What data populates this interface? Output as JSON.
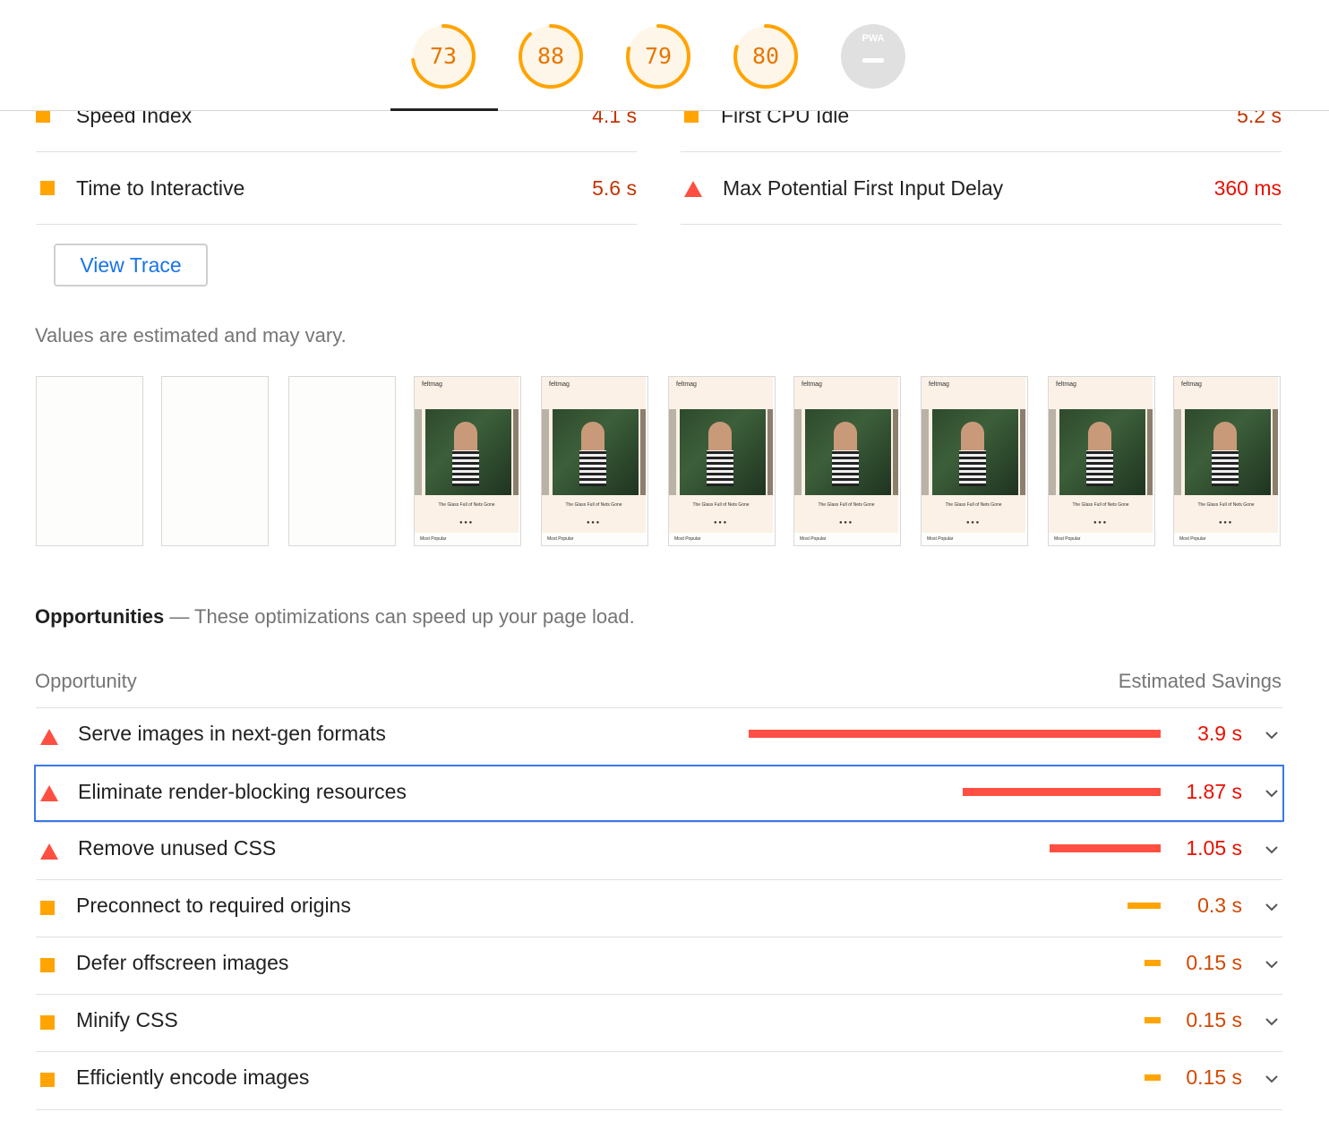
{
  "scores": [
    {
      "value": "73",
      "color": "#ffa400"
    },
    {
      "value": "88",
      "color": "#ffa400"
    },
    {
      "value": "79",
      "color": "#ffa400"
    },
    {
      "value": "80",
      "color": "#ffa400"
    }
  ],
  "pwa": {
    "badge": "PWA"
  },
  "metrics": {
    "speed_index": {
      "label": "Speed Index",
      "value": "4.1 s"
    },
    "first_cpu_idle": {
      "label": "First CPU Idle",
      "value": "5.2 s"
    },
    "tti": {
      "label": "Time to Interactive",
      "value": "5.6 s"
    },
    "max_fid": {
      "label": "Max Potential First Input Delay",
      "value": "360 ms"
    }
  },
  "view_trace_label": "View Trace",
  "estimate_note": "Values are estimated and may vary.",
  "filmstrip": {
    "logo": "feltmag",
    "caption": "The Glass Full of Nets Gone",
    "dots": "● ● ●",
    "footer": "Most Popular"
  },
  "opportunities": {
    "title": "Opportunities",
    "separator": " — ",
    "subtitle": "These optimizations can speed up your page load.",
    "col_opportunity": "Opportunity",
    "col_savings": "Estimated Savings",
    "items": [
      {
        "label": "Serve images in next-gen formats",
        "savings": "3.9 s",
        "severity": "fail",
        "bar_fraction": 1.0
      },
      {
        "label": "Eliminate render-blocking resources",
        "savings": "1.87 s",
        "severity": "fail",
        "bar_fraction": 0.48
      },
      {
        "label": "Remove unused CSS",
        "savings": "1.05 s",
        "severity": "fail",
        "bar_fraction": 0.27
      },
      {
        "label": "Preconnect to required origins",
        "savings": "0.3 s",
        "severity": "average",
        "bar_fraction": 0.08
      },
      {
        "label": "Defer offscreen images",
        "savings": "0.15 s",
        "severity": "average",
        "bar_fraction": 0.04
      },
      {
        "label": "Minify CSS",
        "savings": "0.15 s",
        "severity": "average",
        "bar_fraction": 0.04
      },
      {
        "label": "Efficiently encode images",
        "savings": "0.15 s",
        "severity": "average",
        "bar_fraction": 0.04
      }
    ]
  },
  "colors": {
    "fail": "#ff4e42",
    "average": "#ffa400",
    "pass": "#0cce6b",
    "focus": "#3b78e7"
  }
}
